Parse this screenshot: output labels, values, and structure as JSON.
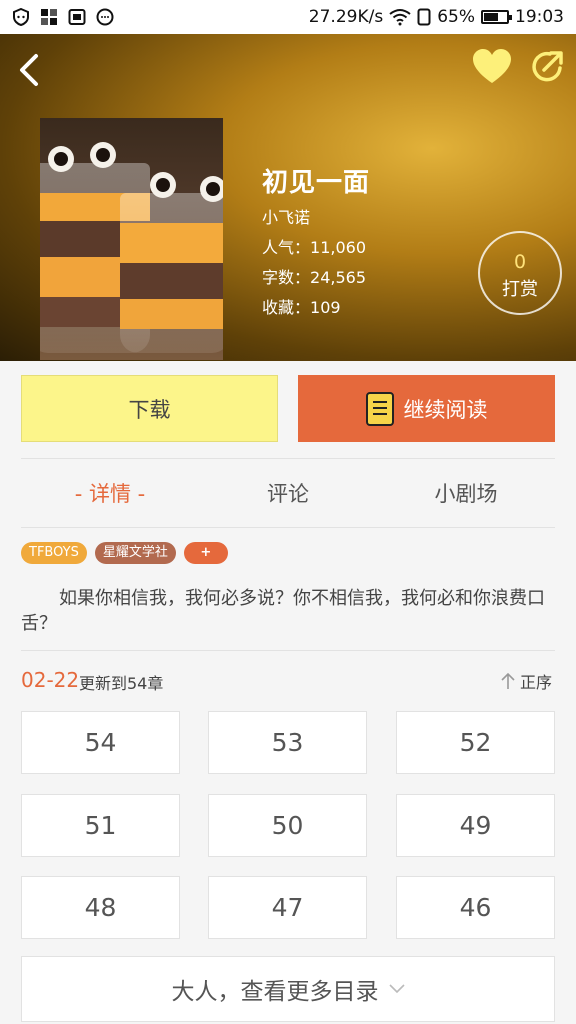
{
  "status_bar": {
    "speed": "27.29K/s",
    "battery": "65%",
    "battery_level": 0.65,
    "time": "19:03"
  },
  "book": {
    "title": "初见一面",
    "author": "小飞诺",
    "stats": [
      {
        "label": "人气：",
        "value": "11,060"
      },
      {
        "label": "字数：",
        "value": "24,565"
      },
      {
        "label": "收藏：",
        "value": "109"
      }
    ],
    "tip_count": "0",
    "tip_label": "打赏"
  },
  "actions": {
    "download": "下载",
    "read": "继续阅读"
  },
  "tabs": [
    "- 详情 -",
    "评论",
    "小剧场"
  ],
  "tags": [
    "TFBOYS",
    "星耀文学社",
    "+"
  ],
  "description": "如果你相信我，我何必多说？你不相信我，我何必和你浪费口舌？",
  "update": {
    "date": "02-22",
    "text": "更新到54章",
    "sort_label": "正序"
  },
  "chapters": [
    "54",
    "53",
    "52",
    "51",
    "50",
    "49",
    "48",
    "47",
    "46"
  ],
  "more_label": "大人，查看更多目录",
  "colors": {
    "accent": "#e5693c",
    "download_bg": "#fcf58a",
    "tag_orange": "#f0a93b",
    "tag_brown": "#b26a4f"
  }
}
